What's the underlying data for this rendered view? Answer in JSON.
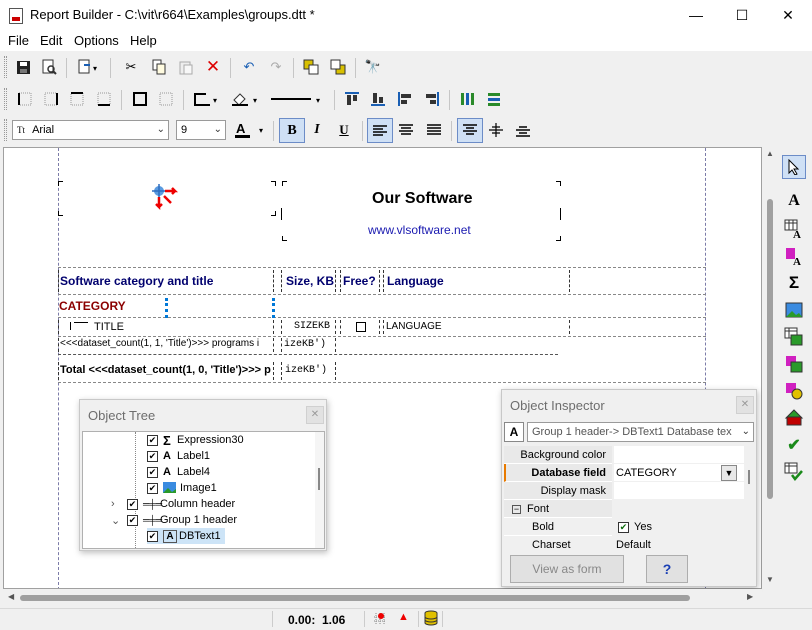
{
  "window": {
    "title": "Report Builder - C:\\vit\\r664\\Examples\\groups.dtt *",
    "minimize": "—",
    "maximize": "☐",
    "close": "✕"
  },
  "menu": {
    "items": [
      "File",
      "Edit",
      "Options",
      "Help"
    ]
  },
  "toolbar": {
    "font_name": "Arial",
    "font_icon": "Tt",
    "font_size": "9",
    "bold": "B",
    "italic": "I",
    "underline": "U"
  },
  "report": {
    "title": "Our Software",
    "url": "www.vlsoftware.net",
    "col_headers": [
      "Software category and title",
      "Size, KB",
      "Free?",
      "Language"
    ],
    "category": "CATEGORY",
    "title_field": "TITLE",
    "size_field": "SIZEKB",
    "language_field": "LANGUAGE",
    "dataset_count_text": "<<<dataset_count(1, 1, 'Title')>>> programs i",
    "dataset_size_text": "izeKB')",
    "total_text": "Total <<<dataset_count(1, 0, 'Title')>>> p",
    "total_size_text": "izeKB')"
  },
  "object_tree": {
    "title": "Object Tree",
    "items": [
      {
        "label": "Expression30",
        "icon": "Σ"
      },
      {
        "label": "Label1",
        "icon": "A"
      },
      {
        "label": "Label4",
        "icon": "A"
      },
      {
        "label": "Image1",
        "icon": "img"
      },
      {
        "label": "Column header",
        "icon": "band",
        "expander": "›"
      },
      {
        "label": "Group 1 header",
        "icon": "band",
        "expander": "⌄"
      },
      {
        "label": "DBText1",
        "icon": "dbA"
      }
    ]
  },
  "inspector": {
    "title": "Object Inspector",
    "selector": "Group 1 header-> DBText1  Database tex",
    "props": [
      {
        "name": "Background color",
        "value": ""
      },
      {
        "name": "Database field",
        "value": "CATEGORY"
      },
      {
        "name": "Display mask",
        "value": ""
      },
      {
        "name": "Font",
        "value": ""
      },
      {
        "name": "Bold",
        "value": "Yes"
      },
      {
        "name": "Charset",
        "value": "Default"
      }
    ],
    "view_as_form": "View as form",
    "help": "?"
  },
  "status": {
    "coords": "0.00:",
    "value": "1.06"
  },
  "colors": {
    "accent": "#0078d7",
    "band_text": "#00006e",
    "category_text": "#8b0000",
    "url_text": "#1a1ab0"
  }
}
